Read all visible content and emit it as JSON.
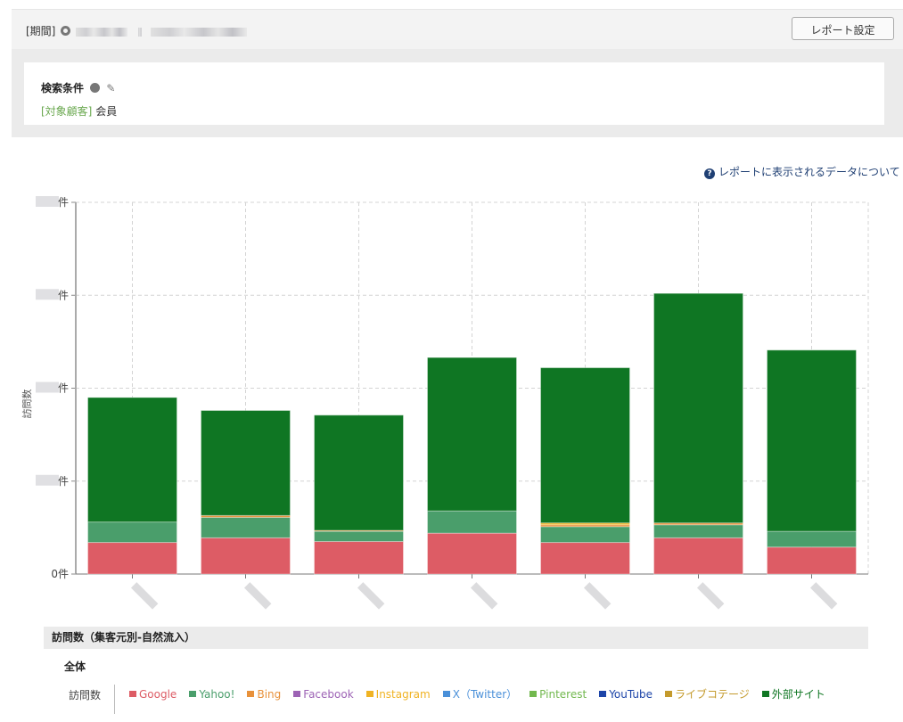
{
  "header": {
    "period_label": "[期間]",
    "period_value_obscured": true,
    "report_settings_button": "レポート設定"
  },
  "conditions": {
    "title": "検索条件",
    "key": "[対象顧客]",
    "value": "会員"
  },
  "help_link": "レポートに表示されるデータについて",
  "legend_section": {
    "title": "訪問数（集客元別-自然流入）",
    "subtitle": "全体",
    "row_label": "訪問数"
  },
  "chart_data": {
    "type": "bar",
    "stacked": true,
    "title": "",
    "xlabel": "",
    "ylabel": "訪問数",
    "y_unit_suffix": "件",
    "y_tick_labels": [
      "0件",
      "■件",
      "■件",
      "■件",
      "■件"
    ],
    "y_tick_labels_note": "non-zero tick numbers are obscured; values below are expressed in gridline units (1 unit = one gridline step)",
    "ylim": [
      0,
      4
    ],
    "grid": true,
    "legend_position": "bottom",
    "categories": [
      "(obscured 1)",
      "(obscured 2)",
      "(obscured 3)",
      "(obscured 4)",
      "(obscured 5)",
      "(obscured 6)",
      "(obscured 7)"
    ],
    "series": [
      {
        "name": "Google",
        "color": "#dd5c65",
        "values": [
          0.34,
          0.39,
          0.35,
          0.44,
          0.34,
          0.39,
          0.29
        ]
      },
      {
        "name": "Yahoo!",
        "color": "#4a9e6b",
        "values": [
          0.22,
          0.22,
          0.11,
          0.24,
          0.17,
          0.14,
          0.17
        ]
      },
      {
        "name": "Bing",
        "color": "#e8913a",
        "values": [
          0.0,
          0.02,
          0.01,
          0.0,
          0.02,
          0.02,
          0.0
        ]
      },
      {
        "name": "Facebook",
        "color": "#9d63b5",
        "values": [
          0,
          0,
          0,
          0,
          0,
          0,
          0
        ]
      },
      {
        "name": "Instagram",
        "color": "#f0b323",
        "values": [
          0,
          0,
          0,
          0,
          0.02,
          0,
          0
        ]
      },
      {
        "name": "X（Twitter）",
        "color": "#4a90d9",
        "values": [
          0,
          0,
          0,
          0,
          0,
          0,
          0
        ]
      },
      {
        "name": "Pinterest",
        "color": "#72b84e",
        "values": [
          0,
          0,
          0,
          0,
          0,
          0,
          0
        ]
      },
      {
        "name": "YouTube",
        "color": "#1c44a8",
        "values": [
          0,
          0,
          0,
          0,
          0,
          0,
          0
        ]
      },
      {
        "name": "ライブコテージ",
        "color": "#c49a2c",
        "values": [
          0,
          0,
          0,
          0,
          0,
          0,
          0
        ]
      },
      {
        "name": "外部サイト",
        "color": "#0f7623",
        "values": [
          1.34,
          1.13,
          1.24,
          1.65,
          1.67,
          2.47,
          1.95
        ]
      }
    ]
  }
}
